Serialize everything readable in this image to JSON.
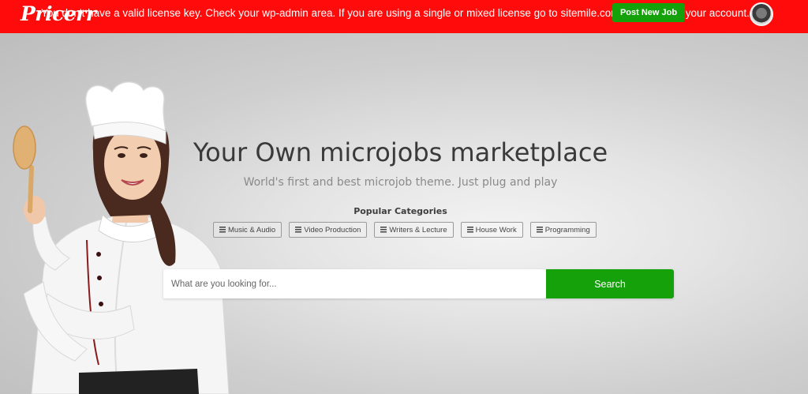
{
  "topbar": {
    "logo_text": "Pricerr",
    "license_warning": "You don't have a valid license key. Check your wp-admin area. If you are using a single or mixed license go to sitemile.com and upgrade your account.",
    "post_job_label": "Post New Job",
    "bar_color": "#ff0b0b",
    "accent_green": "#15a10a"
  },
  "hero": {
    "title": "Your Own microjobs marketplace",
    "subtitle": "World's first and best microjob theme. Just plug and play",
    "popular_categories_title": "Popular Categories",
    "categories": [
      {
        "label": "Music & Audio",
        "icon": "list-icon"
      },
      {
        "label": "Video Production",
        "icon": "list-icon"
      },
      {
        "label": "Writers & Lecture",
        "icon": "list-icon"
      },
      {
        "label": "House Work",
        "icon": "list-icon"
      },
      {
        "label": "Programming",
        "icon": "list-icon"
      }
    ],
    "search": {
      "placeholder": "What are you looking for...",
      "value": "",
      "button_label": "Search"
    },
    "image": "chef-woman-holding-wooden-spoon"
  }
}
